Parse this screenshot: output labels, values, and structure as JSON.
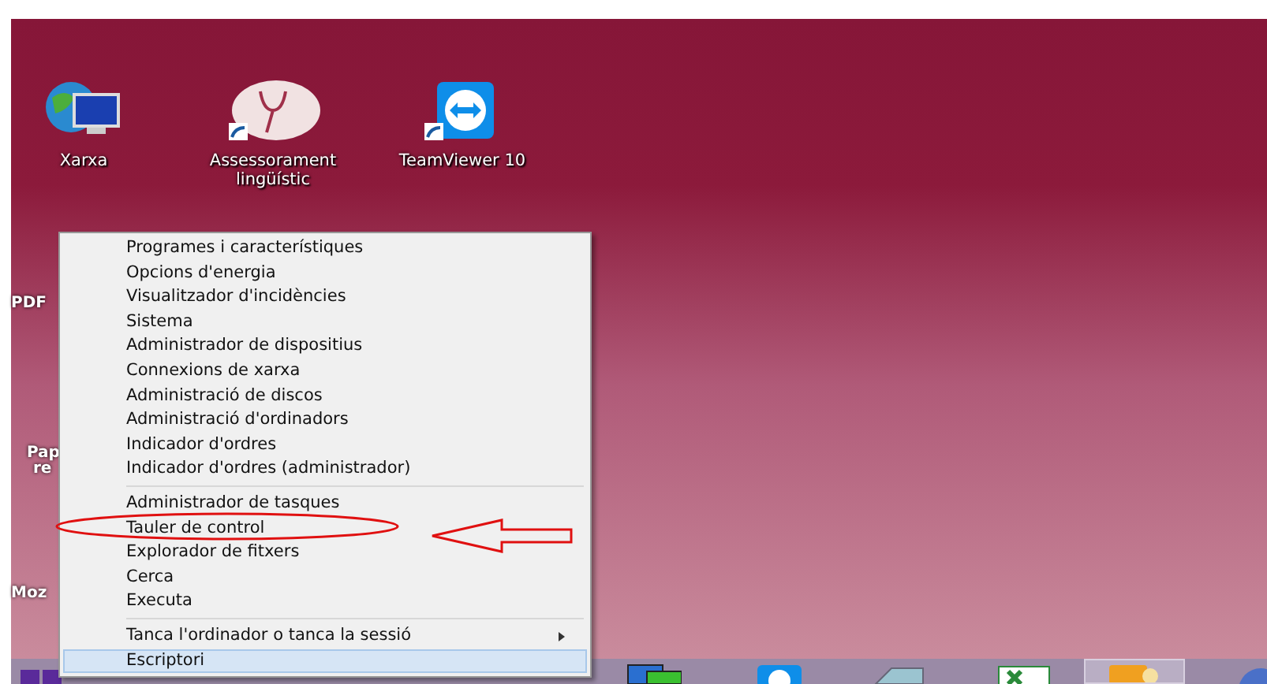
{
  "desktop_icons": [
    {
      "label": "Xarxa",
      "kind": "network"
    },
    {
      "label": "Assessorament lingüístic",
      "kind": "tuning"
    },
    {
      "label": "TeamViewer 10",
      "kind": "teamviewer"
    }
  ],
  "covered_icon_labels": [
    "PDF",
    "Pap",
    "re",
    "Moz"
  ],
  "context_menu": {
    "groups": [
      {
        "items": [
          {
            "label": "Programes i característiques",
            "selected": false,
            "submenu": false
          },
          {
            "label": "Opcions d'energia",
            "selected": false,
            "submenu": false
          },
          {
            "label": "Visualitzador d'incidències",
            "selected": false,
            "submenu": false
          },
          {
            "label": "Sistema",
            "selected": false,
            "submenu": false
          },
          {
            "label": "Administrador de dispositius",
            "selected": false,
            "submenu": false
          },
          {
            "label": "Connexions de xarxa",
            "selected": false,
            "submenu": false
          },
          {
            "label": "Administració de discos",
            "selected": false,
            "submenu": false
          },
          {
            "label": "Administració d'ordinadors",
            "selected": false,
            "submenu": false
          },
          {
            "label": "Indicador d'ordres",
            "selected": false,
            "submenu": false
          },
          {
            "label": "Indicador d'ordres (administrador)",
            "selected": false,
            "submenu": false
          }
        ]
      },
      {
        "items": [
          {
            "label": "Administrador de tasques",
            "selected": false,
            "submenu": false
          },
          {
            "label": "Tauler de control",
            "selected": false,
            "submenu": false
          },
          {
            "label": "Explorador de fitxers",
            "selected": false,
            "submenu": false
          },
          {
            "label": "Cerca",
            "selected": false,
            "submenu": false
          },
          {
            "label": "Executa",
            "selected": false,
            "submenu": false
          }
        ]
      },
      {
        "items": [
          {
            "label": "Tanca l'ordinador o tanca la sessió",
            "selected": false,
            "submenu": true
          },
          {
            "label": "Escriptori",
            "selected": true,
            "submenu": false
          }
        ]
      }
    ]
  },
  "taskbar": {
    "items": [
      {
        "kind": "network",
        "active": false
      },
      {
        "kind": "teamviewer",
        "active": false
      },
      {
        "kind": "box",
        "active": false
      },
      {
        "kind": "excel",
        "active": false
      },
      {
        "kind": "outlook",
        "active": true
      },
      {
        "kind": "globe",
        "active": false
      }
    ]
  }
}
